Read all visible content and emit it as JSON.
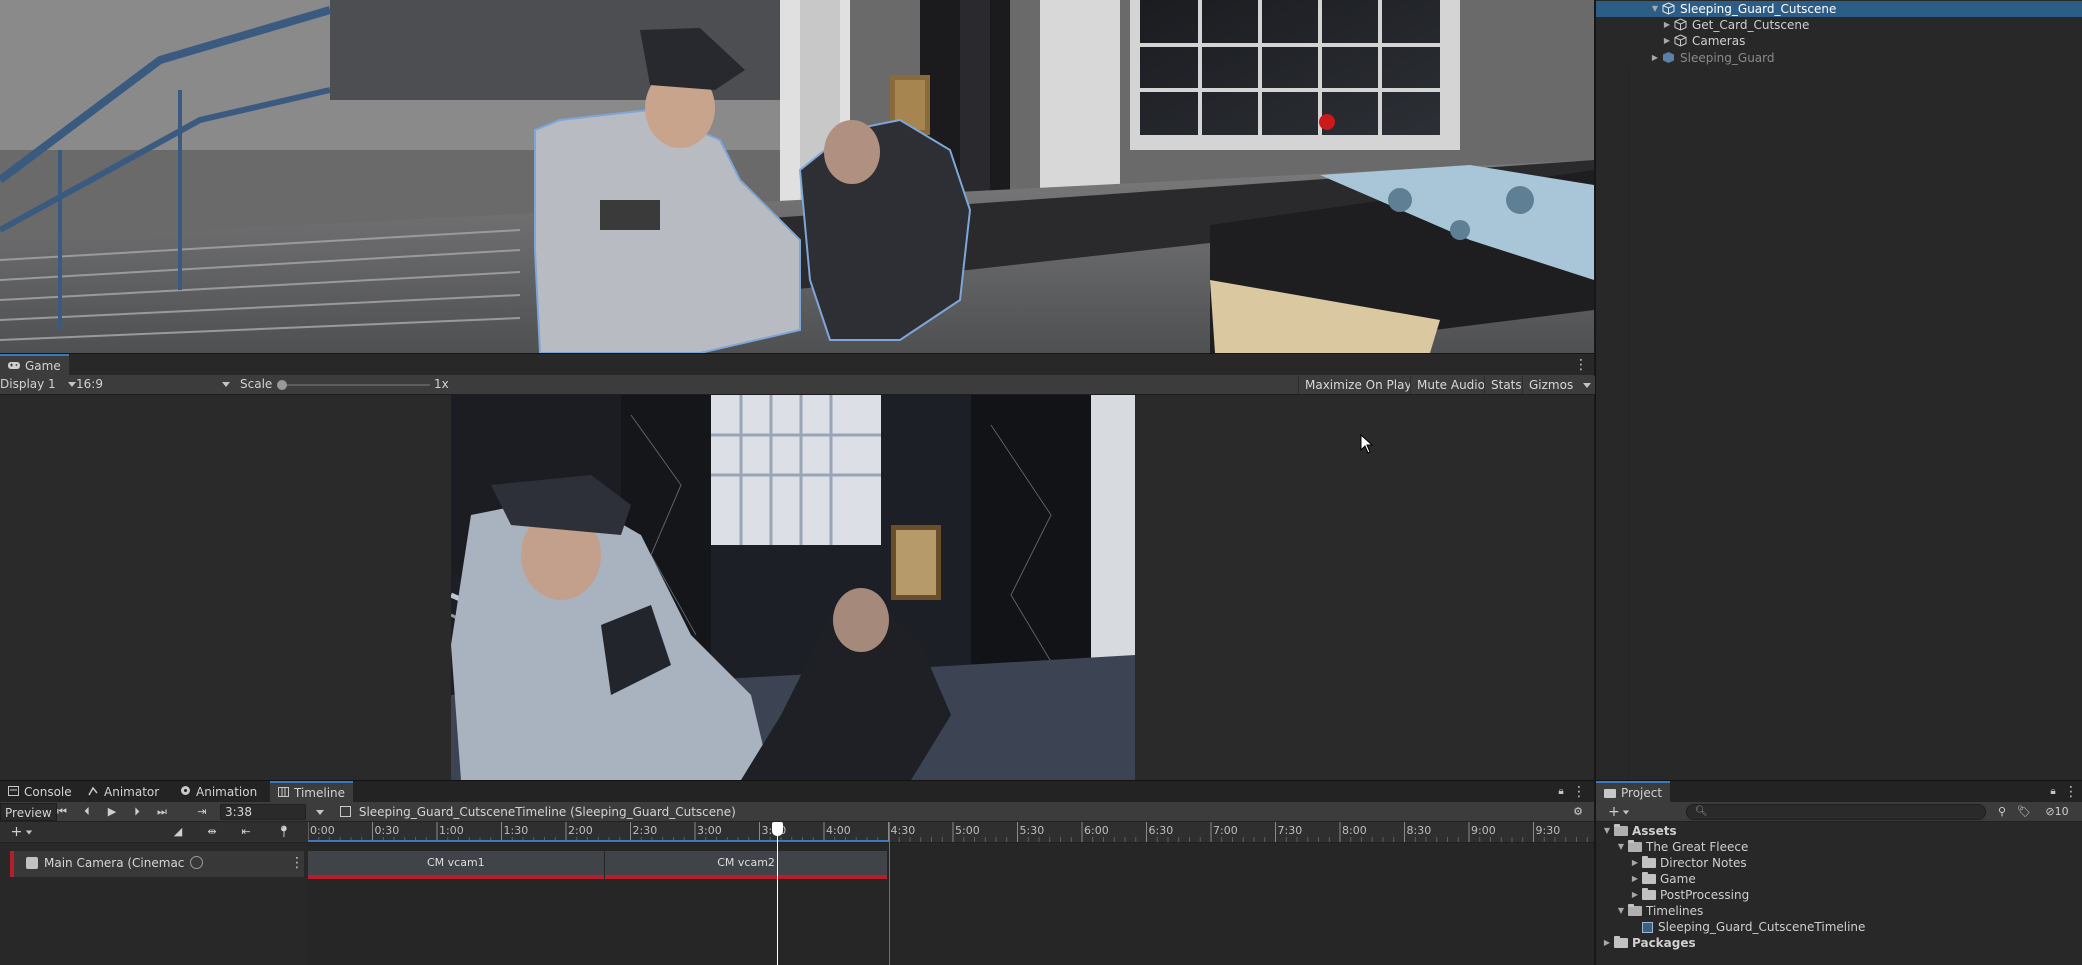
{
  "game_panel": {
    "tab_label": "Game",
    "display": "Display 1",
    "aspect": "16:9",
    "scale_label": "Scale",
    "scale_value": "1x",
    "buttons": [
      "Maximize On Play",
      "Mute Audio",
      "Stats",
      "Gizmos"
    ]
  },
  "timeline_panel": {
    "tabs": [
      {
        "label": "Console",
        "icon": "console-icon"
      },
      {
        "label": "Animator",
        "icon": "animator-icon"
      },
      {
        "label": "Animation",
        "icon": "animation-icon"
      },
      {
        "label": "Timeline",
        "icon": "timeline-icon"
      }
    ],
    "preview_label": "Preview",
    "current_time": "3:38",
    "breadcrumb": "Sleeping_Guard_CutsceneTimeline (Sleeping_Guard_Cutscene)",
    "ruler_ticks": [
      "0:00",
      "0:30",
      "1:00",
      "1:30",
      "2:00",
      "2:30",
      "3:00",
      "3:30",
      "4:00",
      "4:30",
      "5:00",
      "5:30",
      "6:00",
      "6:30",
      "7:00",
      "7:30",
      "8:00",
      "8:30",
      "9:00",
      "9:30"
    ],
    "track": {
      "label": "Main Camera (Cinemac",
      "color": "#b51e2a"
    },
    "clips": [
      {
        "label": "CM vcam1",
        "start": "0:00",
        "end": "2:18"
      },
      {
        "label": "CM vcam2",
        "start": "2:18",
        "end": "4:30"
      }
    ],
    "playhead": "3:38",
    "end_marker": "4:30"
  },
  "hierarchy": {
    "rows": [
      {
        "label": "Sleeping_Guard_Cutscene",
        "selected": true,
        "expanded": true
      },
      {
        "label": "Get_Card_Cutscene",
        "selected": false,
        "expanded": false
      },
      {
        "label": "Cameras",
        "selected": false,
        "expanded": false
      },
      {
        "label": "Sleeping_Guard",
        "selected": false,
        "expanded": false,
        "dimmed": true
      }
    ]
  },
  "project": {
    "tab_label": "Project",
    "visibility_count": "10",
    "tree": [
      {
        "label": "Assets",
        "expanded": true,
        "bold": true
      },
      {
        "label": "The Great Fleece",
        "expanded": true
      },
      {
        "label": "Director Notes",
        "expanded": false
      },
      {
        "label": "Game",
        "expanded": false
      },
      {
        "label": "PostProcessing",
        "expanded": false
      },
      {
        "label": "Timelines",
        "expanded": true
      },
      {
        "label": "Sleeping_Guard_CutsceneTimeline",
        "asset": true
      },
      {
        "label": "Packages",
        "expanded": false,
        "bold": true
      }
    ]
  },
  "colors": {
    "accent": "#3a79bb",
    "selection": "#2c5d87",
    "track_red": "#b51e2a",
    "playhead_white": "#ffffff"
  }
}
